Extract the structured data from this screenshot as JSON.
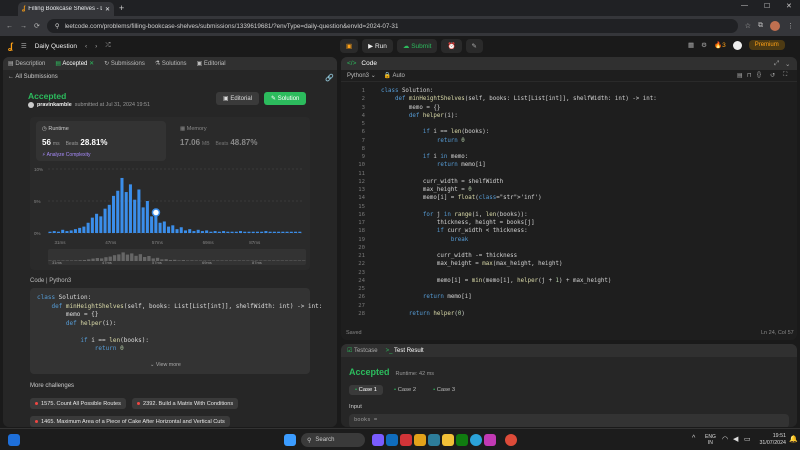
{
  "browser": {
    "tab_title": "Filling Bookcase Shelves - Leet",
    "url": "leetcode.com/problems/filling-bookcase-shelves/submissions/1339619681/?envType=daily-question&envId=2024-07-31"
  },
  "header": {
    "daily_question": "Daily Question",
    "run": "Run",
    "submit": "Submit",
    "streak": "3",
    "premium": "Premium"
  },
  "left_tabs": [
    "Description",
    "Accepted",
    "Submissions",
    "Solutions",
    "Editorial"
  ],
  "back_link": "All Submissions",
  "submission": {
    "status": "Accepted",
    "user": "pravinkamble",
    "submitted_at": "submitted at Jul 31, 2024 19:51",
    "editorial_btn": "Editorial",
    "solution_btn": "Solution"
  },
  "stats": {
    "runtime_label": "Runtime",
    "runtime_value": "56",
    "runtime_unit": "ms",
    "beats_label": "Beats",
    "runtime_beats": "28.81%",
    "analyze": "Analyze Complexity",
    "memory_label": "Memory",
    "memory_value": "17.06",
    "memory_unit": "MB",
    "memory_beats": "48.87%"
  },
  "chart_data": {
    "type": "bar",
    "y_ticks": [
      "10%",
      "5%",
      "0%"
    ],
    "x_ticks": [
      "31ms",
      "47ms",
      "57ms",
      "69ms",
      "87ms"
    ],
    "selected_index": 25,
    "values": [
      0.2,
      0.3,
      0.2,
      0.5,
      0.3,
      0.4,
      0.6,
      0.8,
      1.0,
      1.6,
      2.4,
      3.0,
      2.6,
      3.8,
      4.4,
      5.8,
      6.6,
      8.6,
      6.4,
      7.6,
      5.2,
      6.8,
      4.0,
      5.0,
      2.6,
      3.2,
      1.6,
      1.8,
      1.0,
      1.2,
      0.6,
      0.9,
      0.4,
      0.6,
      0.3,
      0.5,
      0.3,
      0.4,
      0.2,
      0.3,
      0.2,
      0.3,
      0.2,
      0.2,
      0.2,
      0.3,
      0.2,
      0.2,
      0.2,
      0.2,
      0.2,
      0.3,
      0.2,
      0.2,
      0.2,
      0.2,
      0.2,
      0.2,
      0.2,
      0.2
    ],
    "ylim": [
      0,
      10
    ],
    "bar_color": "#3b8eea",
    "highlight_color": "#ffffff"
  },
  "minimap_ticks": [
    "31ms",
    "47ms",
    "57ms",
    "69ms",
    "87ms"
  ],
  "code_label": "Code",
  "code_lang": "Python3",
  "left_code": [
    "class Solution:",
    "    def minHeightShelves(self, books: List[List[int]], shelfWidth: int) -> int:",
    "        memo = {}",
    "        def helper(i):",
    "",
    "            if i == len(books):",
    "                return 0"
  ],
  "view_more": "View more",
  "more_challenges": "More challenges",
  "challenges": [
    "1575. Count All Possible Routes",
    "2392. Build a Matrix With Conditions",
    "1465. Maximum Area of a Piece of Cake After Horizontal and Vertical Cuts"
  ],
  "editor": {
    "title": "Code",
    "language": "Python3",
    "auto": "Auto",
    "saved": "Saved",
    "cursor": "Ln 24, Col 57",
    "lines": [
      "class Solution:",
      "    def minHeightShelves(self, books: List[List[int]], shelfWidth: int) -> int:",
      "        memo = {}",
      "        def helper(i):",
      "",
      "            if i == len(books):",
      "                return 0",
      "",
      "            if i in memo:",
      "                return memo[i]",
      "",
      "            curr_width = shelfWidth",
      "            max_height = 0",
      "            memo[i] = float('inf')",
      "",
      "            for j in range(i, len(books)):",
      "                thickness, height = books[j]",
      "                if curr_width < thickness:",
      "                    break",
      "",
      "                curr_width -= thickness",
      "                max_height = max(max_height, height)",
      "",
      "                memo[i] = min(memo[i], helper(j + 1) + max_height)",
      "",
      "            return memo[i]",
      "",
      "        return helper(0)"
    ]
  },
  "result": {
    "testcase_tab": "Testcase",
    "result_tab": "Test Result",
    "status": "Accepted",
    "runtime": "Runtime: 42 ms",
    "cases": [
      "Case 1",
      "Case 2",
      "Case 3"
    ],
    "input_label": "Input",
    "input_value": "books ="
  },
  "taskbar": {
    "search": "Search",
    "lang": "ENG",
    "region": "IN",
    "time": "19:51",
    "date": "31/07/2024"
  }
}
